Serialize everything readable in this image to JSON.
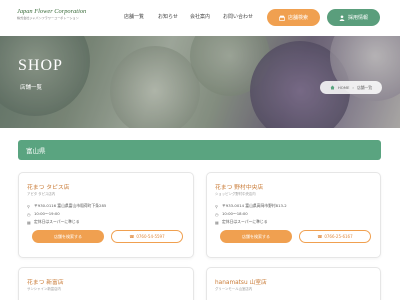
{
  "header": {
    "logo_main": "Japan Flower Corporation",
    "logo_sub": "株式会社ジャパンフラワーコーポレーション",
    "nav": [
      "店舗一覧",
      "お知らせ",
      "会社案内",
      "お問い合わせ"
    ],
    "store_button": "店舗検索",
    "recruit_button": "採用情報"
  },
  "hero": {
    "title": "SHOP",
    "subtitle": "店舗一覧",
    "breadcrumb_home": "HOME",
    "breadcrumb_current": "店舗一覧"
  },
  "region": {
    "title": "富山県"
  },
  "stores": [
    {
      "name": "花まつ タピス店",
      "sub": "アピタ タピス店内",
      "address": "〒930-0116 富山県富山市稲荷町下条285",
      "hours": "10:00〜19:00",
      "holiday": "定休日はスーパーに準じる",
      "detail_button": "店舗を検索する",
      "tel": "0760-54-5597"
    },
    {
      "name": "花まつ 野村中央店",
      "sub": "ショッピング野村中央店内",
      "address": "〒933-0014 富山県高岡市野村813-2",
      "hours": "10:00〜18:00",
      "holiday": "定休日はスーパーに準じる",
      "detail_button": "店舗を検索する",
      "tel": "0766-25-6167"
    },
    {
      "name": "花まつ 新富店",
      "sub": "サンシャイン新富店内"
    },
    {
      "name": "hanamatsu 山室店",
      "sub": "グリーンモール山室店内"
    }
  ]
}
